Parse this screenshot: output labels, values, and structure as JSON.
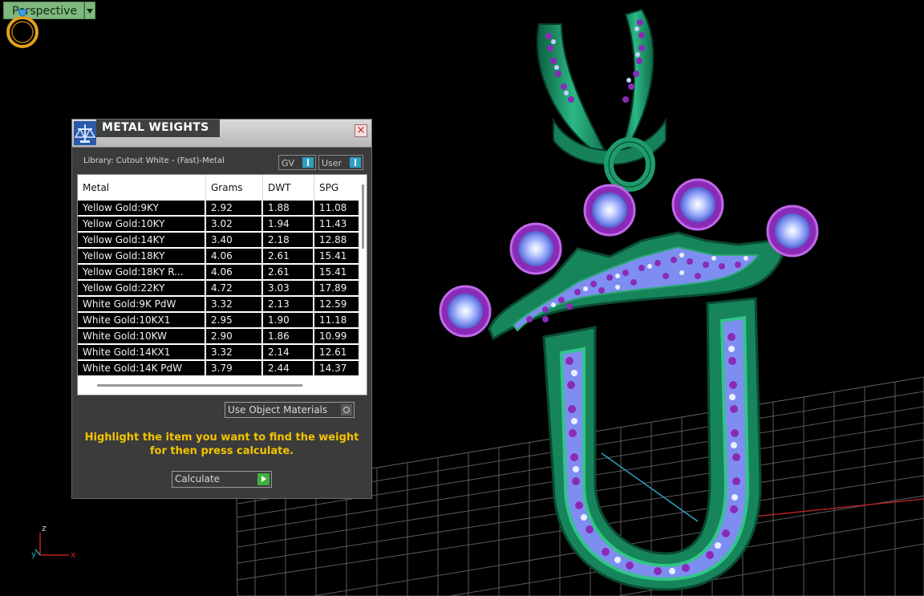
{
  "viewport": {
    "view_label": "Perspective",
    "axis_z": "z",
    "axis_x": "x",
    "axis_y": "y"
  },
  "dialog": {
    "title": "METAL WEIGHTS",
    "library_label": "Library: Cutout White - (Fast)-Metal",
    "toggle_gv": "GV",
    "toggle_user": "User",
    "columns": [
      "Metal",
      "Grams",
      "DWT",
      "SPG"
    ],
    "rows": [
      {
        "metal": "Yellow Gold:9KY",
        "grams": "2.92",
        "dwt": "1.88",
        "spg": "11.08"
      },
      {
        "metal": "Yellow Gold:10KY",
        "grams": "3.02",
        "dwt": "1.94",
        "spg": "11.43"
      },
      {
        "metal": "Yellow Gold:14KY",
        "grams": "3.40",
        "dwt": "2.18",
        "spg": "12.88"
      },
      {
        "metal": "Yellow Gold:18KY",
        "grams": "4.06",
        "dwt": "2.61",
        "spg": "15.41"
      },
      {
        "metal": "Yellow Gold:18KY R...",
        "grams": "4.06",
        "dwt": "2.61",
        "spg": "15.41"
      },
      {
        "metal": "Yellow Gold:22KY",
        "grams": "4.72",
        "dwt": "3.03",
        "spg": "17.89"
      },
      {
        "metal": "White Gold:9K PdW",
        "grams": "3.32",
        "dwt": "2.13",
        "spg": "12.59"
      },
      {
        "metal": "White Gold:10KX1",
        "grams": "2.95",
        "dwt": "1.90",
        "spg": "11.18"
      },
      {
        "metal": "White Gold:10KW",
        "grams": "2.90",
        "dwt": "1.86",
        "spg": "10.99"
      },
      {
        "metal": "White Gold:14KX1",
        "grams": "3.32",
        "dwt": "2.14",
        "spg": "12.61"
      },
      {
        "metal": "White Gold:14K PdW",
        "grams": "3.79",
        "dwt": "2.44",
        "spg": "14.37"
      }
    ],
    "use_object_materials": "Use Object Materials",
    "hint_line1": "Highlight the item you want to find the weight",
    "hint_line2": "for then press calculate.",
    "calculate_label": "Calculate"
  },
  "colors": {
    "metal_green": "#1f9b6c",
    "gem_purple": "#7a1fa0",
    "gem_light": "#b9c8ff",
    "grid": "#7a7a7a",
    "hint_yellow": "#f4c400"
  }
}
